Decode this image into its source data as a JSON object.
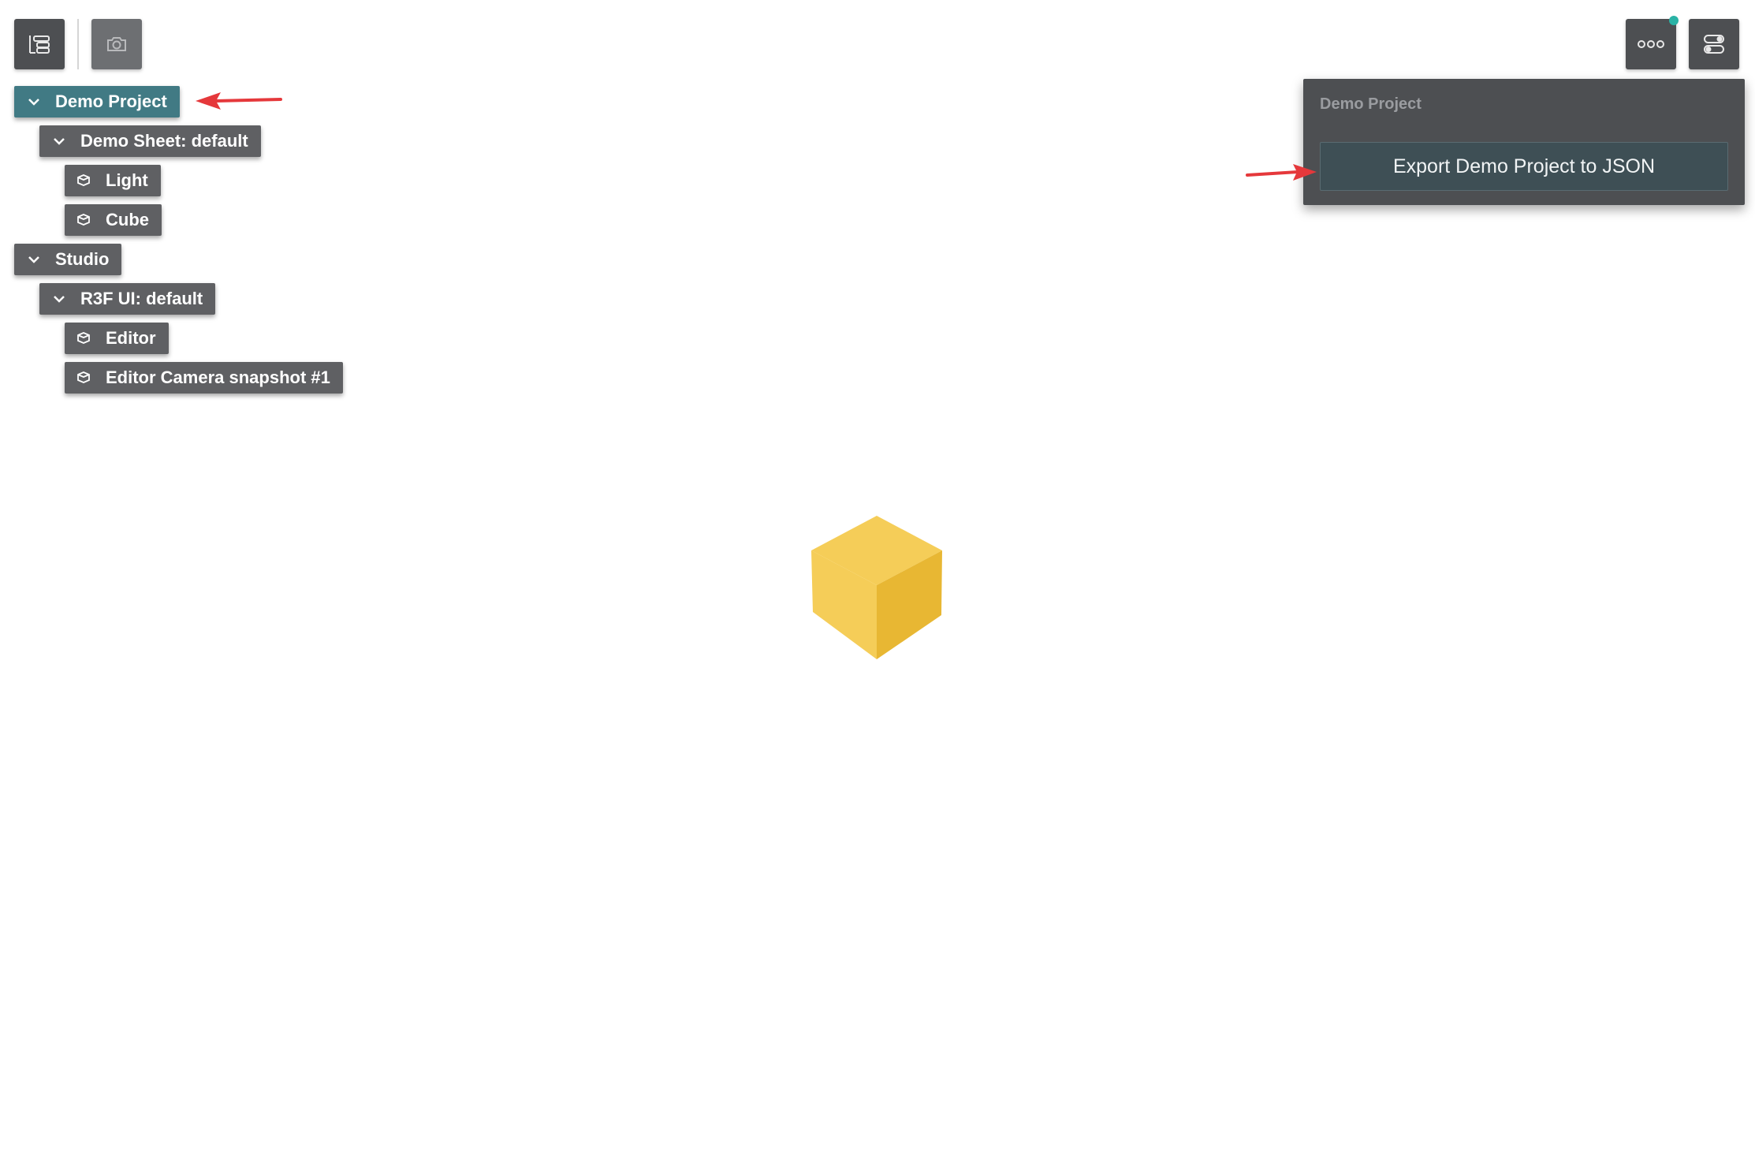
{
  "toolbar": {
    "left": [
      {
        "icon": "outline-tree-icon"
      },
      {
        "icon": "camera-icon"
      }
    ],
    "right": [
      {
        "icon": "more-options-icon",
        "has_notification": true
      },
      {
        "icon": "details-panel-icon"
      }
    ]
  },
  "outline": {
    "project": {
      "label": "Demo Project",
      "selected": true
    },
    "sheet": {
      "label": "Demo Sheet: default"
    },
    "objects": [
      {
        "label": "Light"
      },
      {
        "label": "Cube"
      }
    ],
    "studio": {
      "label": "Studio"
    },
    "studio_sheet": {
      "label": "R3F UI: default"
    },
    "studio_objects": [
      {
        "label": "Editor"
      },
      {
        "label": "Editor Camera snapshot #1"
      }
    ]
  },
  "panel": {
    "title": "Demo Project",
    "export_label": "Export Demo Project to JSON"
  },
  "colors": {
    "node_bg": "#5f6063",
    "selected_bg": "#417a84",
    "toolbar_bg": "#4d4f52",
    "annotation_arrow": "#e5383b",
    "notify_dot": "#2ab3a6",
    "cube_light": "#f5cd58",
    "cube_dark": "#e8b733"
  }
}
